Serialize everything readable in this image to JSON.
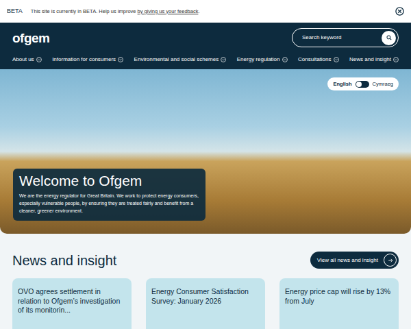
{
  "beta_banner": {
    "label": "BETA",
    "text": "This site is currently in BETA. Help us improve ",
    "link": "by giving us your feedback",
    "suffix": "."
  },
  "header": {
    "logo": "ofgem",
    "search": {
      "placeholder": "Search keyword"
    }
  },
  "nav": [
    {
      "label": "About us"
    },
    {
      "label": "Information for consumers"
    },
    {
      "label": "Environmental and social schemes"
    },
    {
      "label": "Energy regulation"
    },
    {
      "label": "Consultations"
    },
    {
      "label": "News and insight"
    }
  ],
  "hero": {
    "language": [
      {
        "label": "English",
        "selected": true
      },
      {
        "label": "Cymraeg",
        "selected": false
      }
    ],
    "title": "Welcome to Ofgem",
    "text": "We are the energy regulator for Great Britain. We work to protect energy consumers, especially vulnerable people, by ensuring they are treated fairly and benefit from a cleaner, greener environment."
  },
  "news": {
    "title": "News and insight",
    "button": "View all news and insight",
    "cards": [
      {
        "title": "OVO agrees settlement in relation to Ofgem’s investigation of its monitorin..."
      },
      {
        "title": "Energy Consumer Satisfaction Survey: January 2026"
      },
      {
        "title": "Energy price cap will rise by 13% from July"
      }
    ]
  }
}
